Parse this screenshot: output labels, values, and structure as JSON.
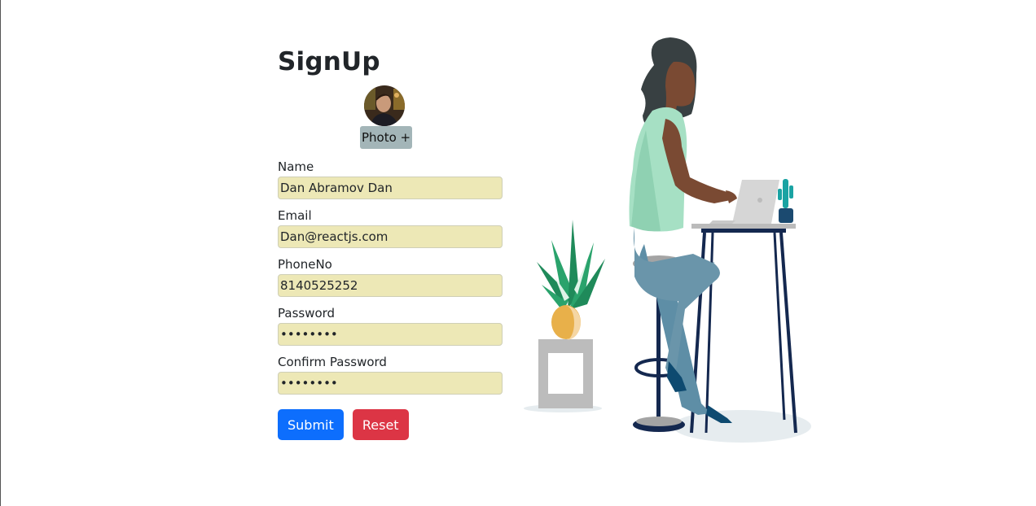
{
  "form": {
    "title": "SignUp",
    "photo_button_label": "Photo +",
    "fields": [
      {
        "label": "Name",
        "value": "Dan Abramov Dan",
        "type": "text"
      },
      {
        "label": "Email",
        "value": "Dan@reactjs.com",
        "type": "text"
      },
      {
        "label": "PhoneNo",
        "value": "8140525252",
        "type": "text"
      },
      {
        "label": "Password",
        "value": "abcdefgh",
        "type": "password"
      },
      {
        "label": "Confirm Password",
        "value": "abcdefgh",
        "type": "password"
      }
    ],
    "submit_label": "Submit",
    "reset_label": "Reset"
  },
  "colors": {
    "primary": "#0d6efd",
    "danger": "#dc3545",
    "input_bg": "#ede8b6",
    "photo_button_bg": "#a3b5b8"
  },
  "icons": [
    "avatar",
    "woman-at-laptop-illustration",
    "potted-plant-illustration"
  ]
}
